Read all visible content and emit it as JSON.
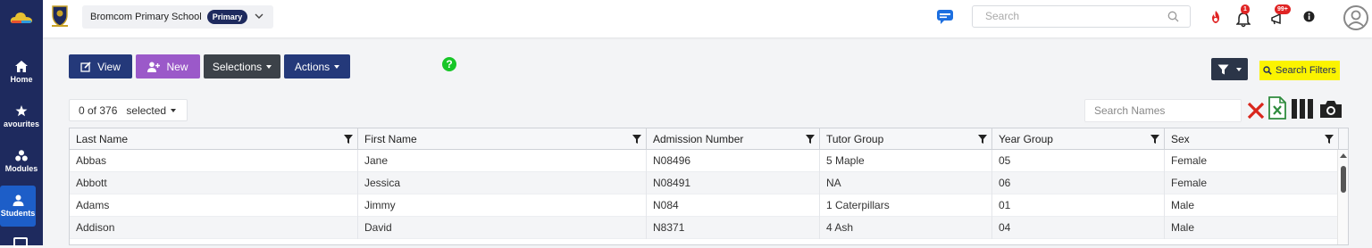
{
  "topbar": {
    "school_name": "Bromcom Primary School",
    "school_badge": "Primary",
    "search_placeholder": "Search",
    "notifications_count": "1",
    "announcements_count": "99+"
  },
  "sidebar": {
    "items": [
      {
        "label": "Home",
        "icon": "home-icon"
      },
      {
        "label": "avourites",
        "icon": "star-icon"
      },
      {
        "label": "Modules",
        "icon": "modules-icon"
      },
      {
        "label": "Students",
        "icon": "user-icon"
      }
    ]
  },
  "toolbar": {
    "view_label": "View",
    "new_label": "New",
    "selections_label": "Selections",
    "actions_label": "Actions",
    "search_filters_label": "Search Filters"
  },
  "list": {
    "selected_count": "0 of 376",
    "selected_label": "selected",
    "search_names_placeholder": "Search Names"
  },
  "table": {
    "columns": [
      "Last Name",
      "First Name",
      "Admission Number",
      "Tutor Group",
      "Year Group",
      "Sex"
    ],
    "rows": [
      [
        "Abbas",
        "Jane",
        "N08496",
        "5 Maple",
        "05",
        "Female"
      ],
      [
        "Abbott",
        "Jessica",
        "N08491",
        "NA",
        "06",
        "Female"
      ],
      [
        "Adams",
        "Jimmy",
        "N084",
        "1 Caterpillars",
        "01",
        "Male"
      ],
      [
        "Addison",
        "David",
        "N8371",
        "4 Ash",
        "04",
        "Male"
      ]
    ]
  },
  "colors": {
    "sidebar_bg": "#1e2a5e",
    "primary": "#24397a",
    "new_button": "#9b59c9",
    "selections_button": "#3c4249",
    "highlight": "#fbf300",
    "help_green": "#17c627",
    "excel_green": "#2e8b3d",
    "delete_red": "#d9261c"
  }
}
